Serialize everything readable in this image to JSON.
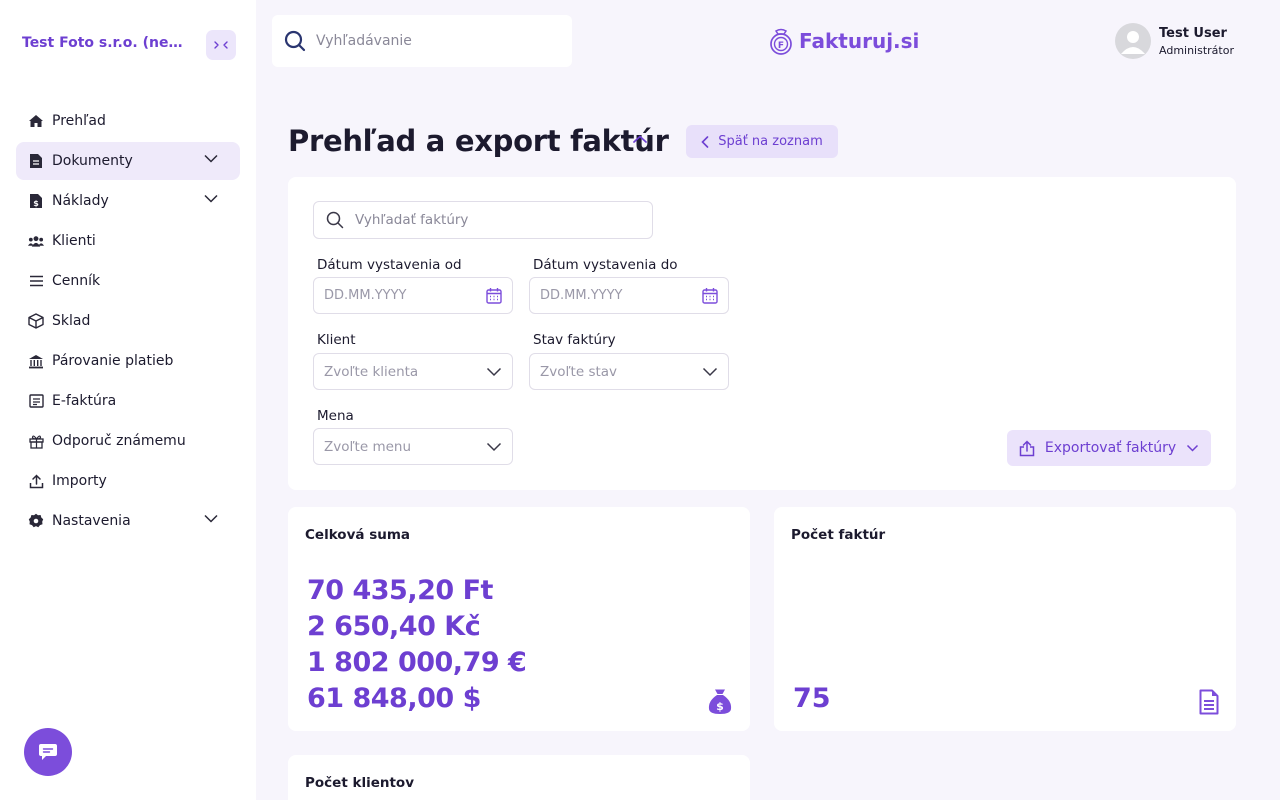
{
  "sidebar": {
    "company": "Test Foto s.r.o. (neplat...",
    "items": [
      {
        "label": "Prehľad",
        "icon": "home-icon"
      },
      {
        "label": "Dokumenty",
        "icon": "document-icon",
        "expandable": true,
        "active": true
      },
      {
        "label": "Náklady",
        "icon": "expense-document-icon",
        "expandable": true
      },
      {
        "label": "Klienti",
        "icon": "users-icon"
      },
      {
        "label": "Cenník",
        "icon": "list-icon"
      },
      {
        "label": "Sklad",
        "icon": "box-icon"
      },
      {
        "label": "Párovanie platieb",
        "icon": "bank-icon"
      },
      {
        "label": "E-faktúra",
        "icon": "invoice-icon"
      },
      {
        "label": "Odporuč známemu",
        "icon": "gift-icon"
      },
      {
        "label": "Importy",
        "icon": "upload-icon"
      },
      {
        "label": "Nastavenia",
        "icon": "settings-icon",
        "expandable": true
      }
    ]
  },
  "header": {
    "search_placeholder": "Vyhľadávanie",
    "brand": "Fakturuj.si",
    "user_name": "Test User",
    "user_role": "Administrátor"
  },
  "page": {
    "title": "Prehľad a export faktúr",
    "back_label": "Späť na zoznam"
  },
  "filters": {
    "search_placeholder": "Vyhľadať faktúry",
    "date_from_label": "Dátum vystavenia od",
    "date_from_placeholder": "DD.MM.YYYY",
    "date_to_label": "Dátum vystavenia do",
    "date_to_placeholder": "DD.MM.YYYY",
    "client_label": "Klient",
    "client_placeholder": "Zvoľte klienta",
    "status_label": "Stav faktúry",
    "status_placeholder": "Zvoľte stav",
    "currency_label": "Mena",
    "currency_placeholder": "Zvoľte menu",
    "export_label": "Exportovať faktúry"
  },
  "stats": {
    "total_title": "Celková suma",
    "totals": [
      "70 435,20 Ft",
      "2 650,40 Kč",
      "1 802 000,79 €",
      "61 848,00 $"
    ],
    "count_title": "Počet faktúr",
    "count_value": "75",
    "clients_title": "Počet klientov"
  },
  "colors": {
    "accent": "#6d3fd1",
    "accent_light": "#ebe3fb",
    "background": "#f7f5fc"
  }
}
